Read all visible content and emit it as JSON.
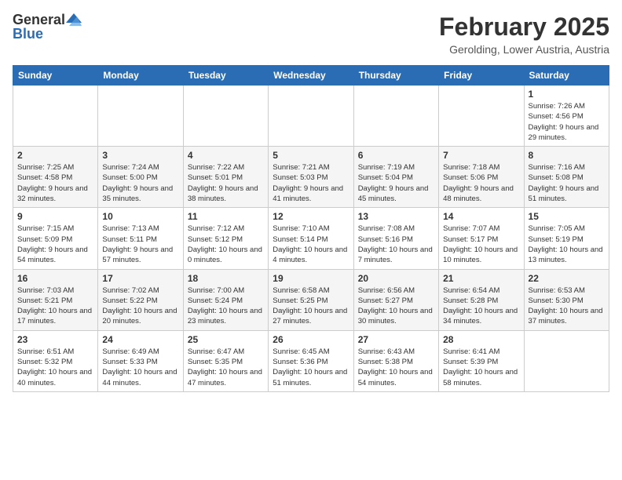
{
  "header": {
    "logo_general": "General",
    "logo_blue": "Blue",
    "month_year": "February 2025",
    "location": "Gerolding, Lower Austria, Austria"
  },
  "days_of_week": [
    "Sunday",
    "Monday",
    "Tuesday",
    "Wednesday",
    "Thursday",
    "Friday",
    "Saturday"
  ],
  "weeks": [
    [
      {
        "day": "",
        "info": ""
      },
      {
        "day": "",
        "info": ""
      },
      {
        "day": "",
        "info": ""
      },
      {
        "day": "",
        "info": ""
      },
      {
        "day": "",
        "info": ""
      },
      {
        "day": "",
        "info": ""
      },
      {
        "day": "1",
        "info": "Sunrise: 7:26 AM\nSunset: 4:56 PM\nDaylight: 9 hours and 29 minutes."
      }
    ],
    [
      {
        "day": "2",
        "info": "Sunrise: 7:25 AM\nSunset: 4:58 PM\nDaylight: 9 hours and 32 minutes."
      },
      {
        "day": "3",
        "info": "Sunrise: 7:24 AM\nSunset: 5:00 PM\nDaylight: 9 hours and 35 minutes."
      },
      {
        "day": "4",
        "info": "Sunrise: 7:22 AM\nSunset: 5:01 PM\nDaylight: 9 hours and 38 minutes."
      },
      {
        "day": "5",
        "info": "Sunrise: 7:21 AM\nSunset: 5:03 PM\nDaylight: 9 hours and 41 minutes."
      },
      {
        "day": "6",
        "info": "Sunrise: 7:19 AM\nSunset: 5:04 PM\nDaylight: 9 hours and 45 minutes."
      },
      {
        "day": "7",
        "info": "Sunrise: 7:18 AM\nSunset: 5:06 PM\nDaylight: 9 hours and 48 minutes."
      },
      {
        "day": "8",
        "info": "Sunrise: 7:16 AM\nSunset: 5:08 PM\nDaylight: 9 hours and 51 minutes."
      }
    ],
    [
      {
        "day": "9",
        "info": "Sunrise: 7:15 AM\nSunset: 5:09 PM\nDaylight: 9 hours and 54 minutes."
      },
      {
        "day": "10",
        "info": "Sunrise: 7:13 AM\nSunset: 5:11 PM\nDaylight: 9 hours and 57 minutes."
      },
      {
        "day": "11",
        "info": "Sunrise: 7:12 AM\nSunset: 5:12 PM\nDaylight: 10 hours and 0 minutes."
      },
      {
        "day": "12",
        "info": "Sunrise: 7:10 AM\nSunset: 5:14 PM\nDaylight: 10 hours and 4 minutes."
      },
      {
        "day": "13",
        "info": "Sunrise: 7:08 AM\nSunset: 5:16 PM\nDaylight: 10 hours and 7 minutes."
      },
      {
        "day": "14",
        "info": "Sunrise: 7:07 AM\nSunset: 5:17 PM\nDaylight: 10 hours and 10 minutes."
      },
      {
        "day": "15",
        "info": "Sunrise: 7:05 AM\nSunset: 5:19 PM\nDaylight: 10 hours and 13 minutes."
      }
    ],
    [
      {
        "day": "16",
        "info": "Sunrise: 7:03 AM\nSunset: 5:21 PM\nDaylight: 10 hours and 17 minutes."
      },
      {
        "day": "17",
        "info": "Sunrise: 7:02 AM\nSunset: 5:22 PM\nDaylight: 10 hours and 20 minutes."
      },
      {
        "day": "18",
        "info": "Sunrise: 7:00 AM\nSunset: 5:24 PM\nDaylight: 10 hours and 23 minutes."
      },
      {
        "day": "19",
        "info": "Sunrise: 6:58 AM\nSunset: 5:25 PM\nDaylight: 10 hours and 27 minutes."
      },
      {
        "day": "20",
        "info": "Sunrise: 6:56 AM\nSunset: 5:27 PM\nDaylight: 10 hours and 30 minutes."
      },
      {
        "day": "21",
        "info": "Sunrise: 6:54 AM\nSunset: 5:28 PM\nDaylight: 10 hours and 34 minutes."
      },
      {
        "day": "22",
        "info": "Sunrise: 6:53 AM\nSunset: 5:30 PM\nDaylight: 10 hours and 37 minutes."
      }
    ],
    [
      {
        "day": "23",
        "info": "Sunrise: 6:51 AM\nSunset: 5:32 PM\nDaylight: 10 hours and 40 minutes."
      },
      {
        "day": "24",
        "info": "Sunrise: 6:49 AM\nSunset: 5:33 PM\nDaylight: 10 hours and 44 minutes."
      },
      {
        "day": "25",
        "info": "Sunrise: 6:47 AM\nSunset: 5:35 PM\nDaylight: 10 hours and 47 minutes."
      },
      {
        "day": "26",
        "info": "Sunrise: 6:45 AM\nSunset: 5:36 PM\nDaylight: 10 hours and 51 minutes."
      },
      {
        "day": "27",
        "info": "Sunrise: 6:43 AM\nSunset: 5:38 PM\nDaylight: 10 hours and 54 minutes."
      },
      {
        "day": "28",
        "info": "Sunrise: 6:41 AM\nSunset: 5:39 PM\nDaylight: 10 hours and 58 minutes."
      },
      {
        "day": "",
        "info": ""
      }
    ]
  ]
}
